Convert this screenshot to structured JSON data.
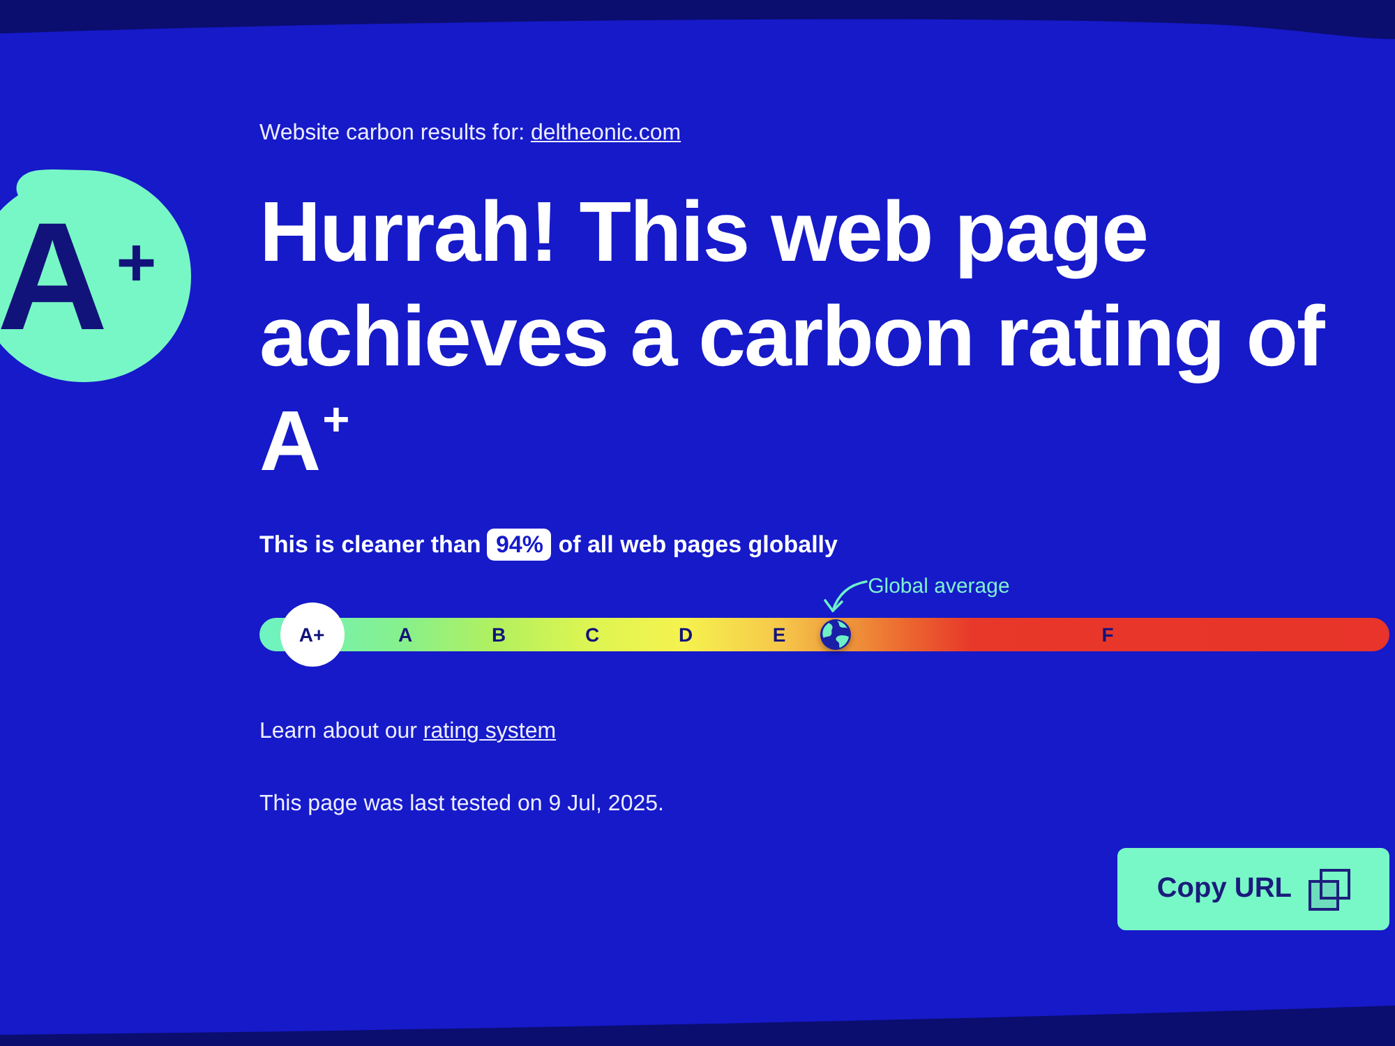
{
  "header": {
    "label": "Website carbon results for:",
    "link": "deltheonic.com"
  },
  "grade_badge": {
    "grade": "A$^{+}$"
  },
  "heading": "Hurrah! This web page achieves a carbon rating of A$^{+}$",
  "comparison": {
    "prefix": "This is cleaner than",
    "percentile": "94%",
    "suffix": "of all web pages globally"
  },
  "rating_scale": {
    "grades": [
      {
        "label": "A+",
        "selected": true
      },
      {
        "label": "A",
        "selected": false
      },
      {
        "label": "B",
        "selected": false
      },
      {
        "label": "C",
        "selected": false
      },
      {
        "label": "D",
        "selected": false
      },
      {
        "label": "E",
        "selected": false
      },
      {
        "label": "F",
        "selected": false
      }
    ],
    "marker": {
      "label": "Global average",
      "level": 0.51
    }
  },
  "learn_more": {
    "text": "Learn about our",
    "link": "rating system"
  },
  "last_tested": "This page was last tested on 9 Jul, 2025.",
  "copy_button": {
    "label": "Copy URL"
  }
}
